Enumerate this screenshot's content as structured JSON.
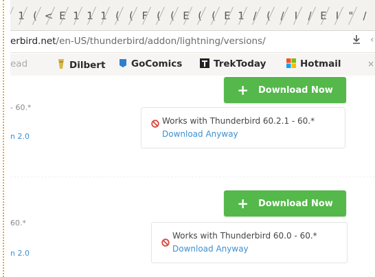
{
  "tab_strip": {
    "glyphs": [
      "1",
      "(",
      "<",
      "E",
      "1",
      "1",
      "1",
      "(",
      "(",
      "F",
      "(",
      "(",
      "E",
      "(",
      "(",
      "E",
      "1",
      "/",
      "(",
      "/",
      "I",
      "/",
      "E",
      "I",
      "\"",
      "/"
    ]
  },
  "url_bar": {
    "host": "erbird.net",
    "path": "/en-US/thunderbird/addon/lightning/versions/",
    "download_icon": "download-arrow-icon",
    "more_glyph": "‹"
  },
  "bookmarks": {
    "items": [
      {
        "label": "ead",
        "icon": "none"
      },
      {
        "label": "Dilbert",
        "icon": "dilbert-icon",
        "color": "#d6b84a"
      },
      {
        "label": "GoComics",
        "icon": "gocomics-icon",
        "color": "#2f7fcf"
      },
      {
        "label": "TrekToday",
        "icon": "trektoday-icon",
        "color": "#222222"
      },
      {
        "label": "Hotmail",
        "icon": "hotmail-icon",
        "color": "#f3a21b"
      }
    ],
    "close_glyph": "×"
  },
  "versions": [
    {
      "side_range": "- 60.*",
      "side_link": "n 2.0",
      "download_label": "Download Now",
      "works_text": "Works with Thunderbird 60.2.1 - 60.*",
      "anyway_label": "Download Anyway"
    },
    {
      "side_range": "60.*",
      "side_link": "n 2.0",
      "download_label": "Download Now",
      "works_text": "Works with Thunderbird 60.0 - 60.*",
      "anyway_label": "Download Anyway"
    }
  ],
  "colors": {
    "download_button": "#54b84a",
    "link": "#3b8fd1",
    "block_icon": "#d9453a",
    "side_marker": "#e8a33c"
  }
}
